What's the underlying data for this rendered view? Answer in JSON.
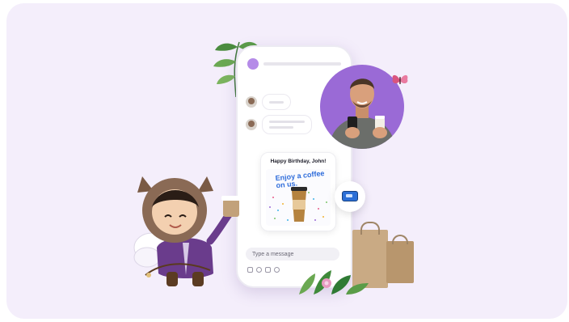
{
  "gift_card": {
    "title": "Happy Birthday, John!",
    "headline": "Enjoy a coffee on us."
  },
  "chat": {
    "input_placeholder": "Type a message"
  },
  "icons": {
    "wallet_badge": "wallet-card-icon",
    "butterfly": "butterfly-icon",
    "attach": "attach-icon",
    "emoji": "emoji-icon",
    "camera": "camera-icon",
    "link": "link-icon"
  },
  "colors": {
    "card_background": "#f4eefb",
    "accent_purple": "#9a6ad6",
    "accent_blue": "#2f6ddb",
    "bag_kraft": "#c9aa84"
  }
}
